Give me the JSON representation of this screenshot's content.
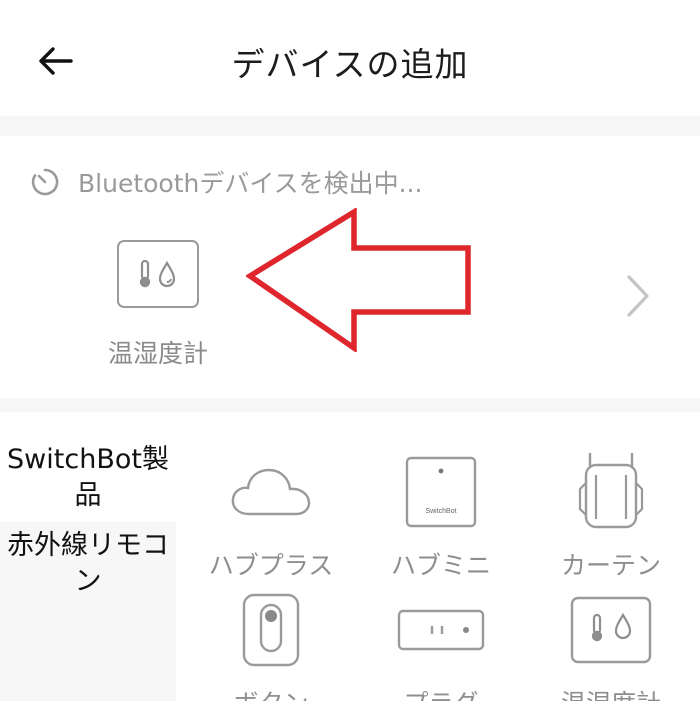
{
  "header": {
    "title": "デバイスの追加"
  },
  "scan": {
    "status_text": "Bluetoothデバイスを検出中...",
    "found_devices": [
      {
        "label": "温湿度計",
        "icon": "thermo-hygrometer-icon"
      }
    ]
  },
  "categories": [
    {
      "label": "SwitchBot製品",
      "active": true
    },
    {
      "label": "赤外線リモコン",
      "active": false
    }
  ],
  "products": [
    {
      "label": "ハブプラス",
      "icon": "cloud-icon"
    },
    {
      "label": "ハブミニ",
      "icon": "hub-mini-icon",
      "brand_text": "SwitchBot"
    },
    {
      "label": "カーテン",
      "icon": "curtain-icon"
    },
    {
      "label": "ボタン",
      "icon": "button-icon"
    },
    {
      "label": "プラグ",
      "icon": "plug-icon"
    },
    {
      "label": "温湿度計",
      "icon": "thermo-hygrometer-icon"
    }
  ],
  "colors": {
    "annotation_red": "#e0262d",
    "icon_gray": "#9a9a9a",
    "section_bg": "#f6f6f6"
  }
}
